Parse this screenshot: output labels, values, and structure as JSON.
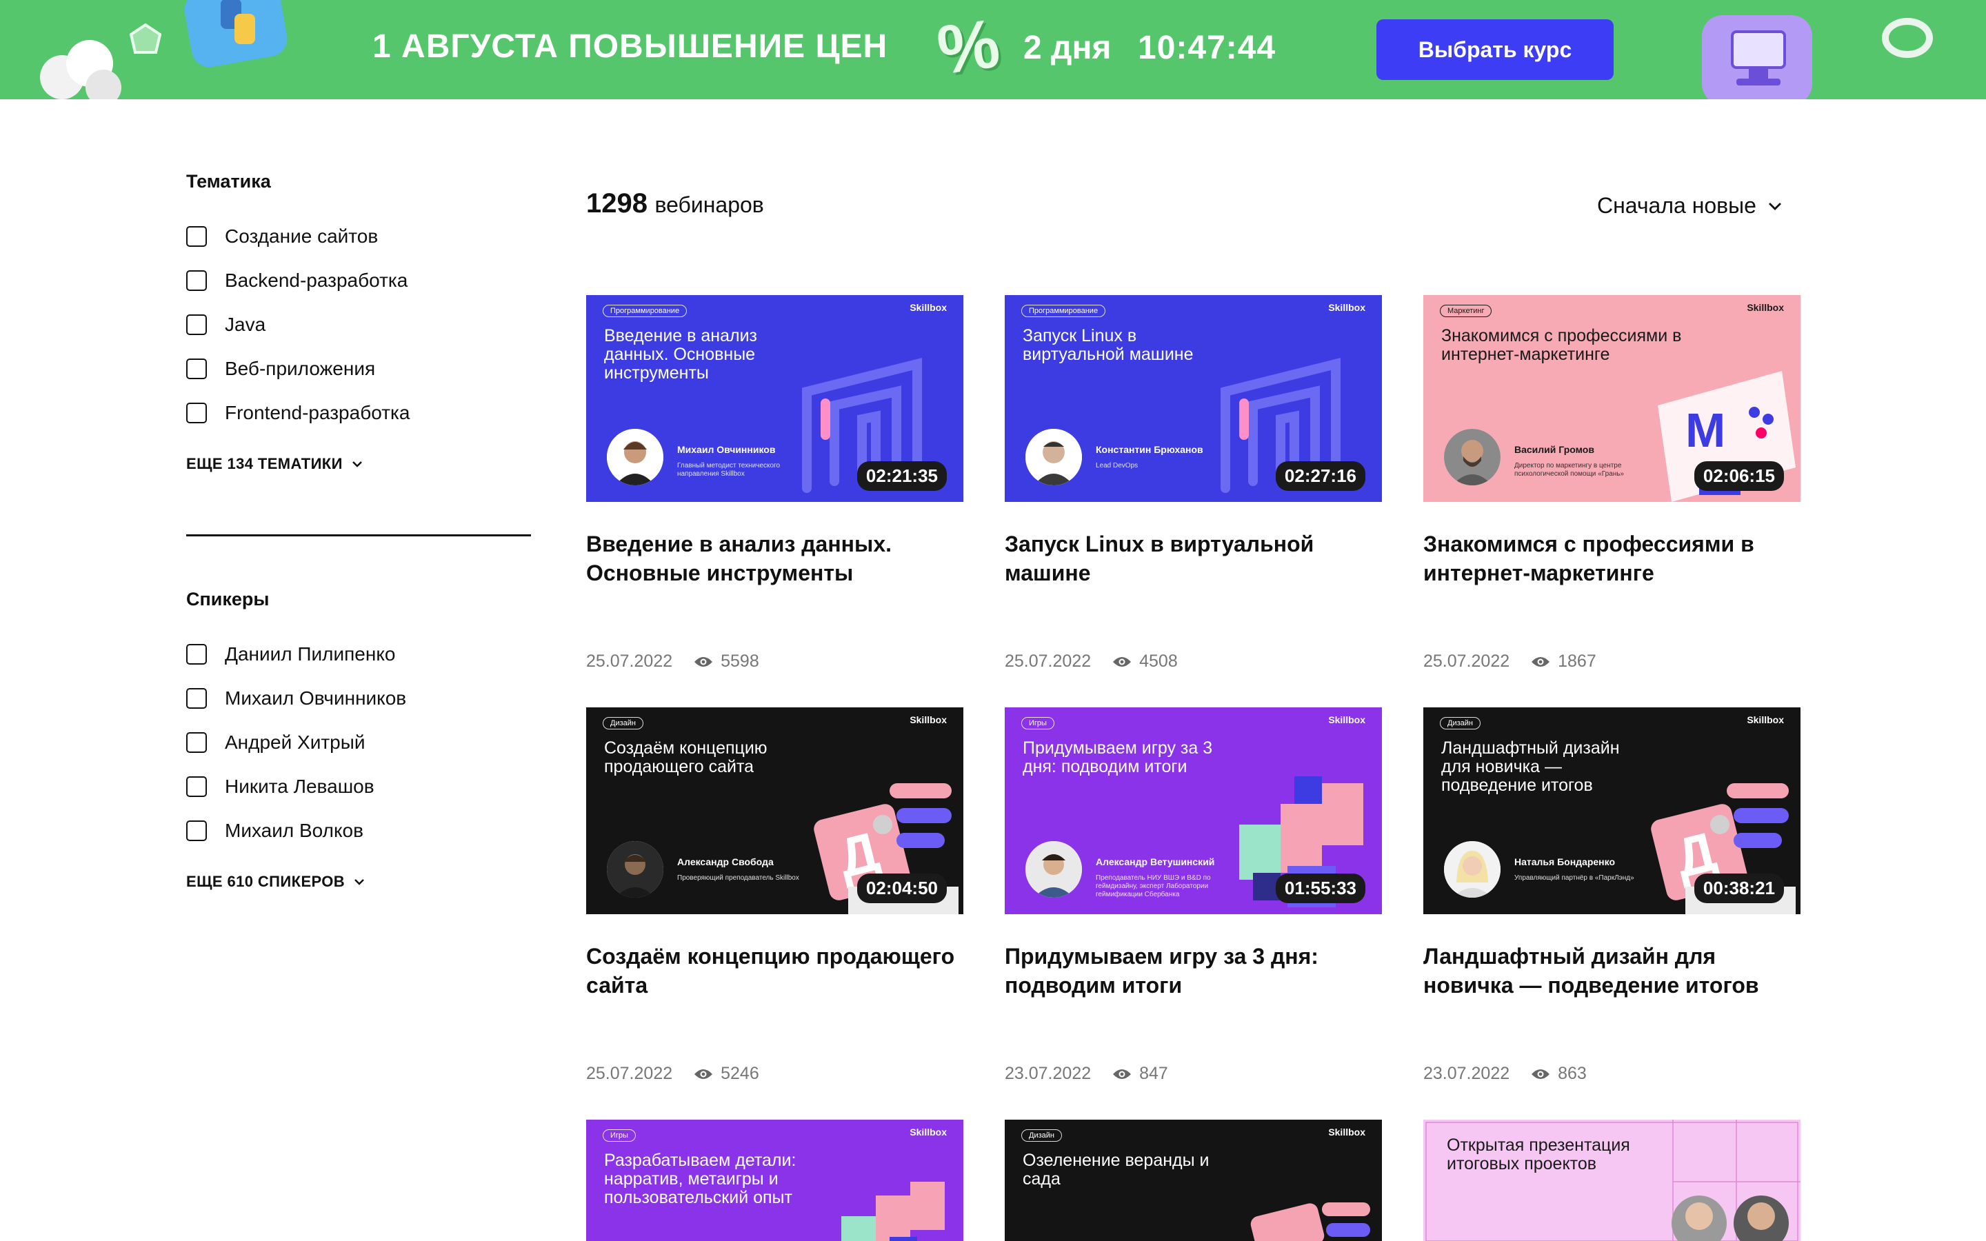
{
  "banner": {
    "title": "1 АВГУСТА ПОВЫШЕНИЕ ЦЕН",
    "percent": "%",
    "days": "2 дня",
    "timer": "10:47:44",
    "button": "Выбрать курс",
    "colors": {
      "background": "#56c66c",
      "button": "#3d3df5"
    }
  },
  "filters": {
    "topics": {
      "title": "Тематика",
      "items": [
        "Создание сайтов",
        "Backend-разработка",
        "Java",
        "Веб-приложения",
        "Frontend-разработка"
      ],
      "more": "ЕЩЕ 134 ТЕМАТИКИ"
    },
    "speakers": {
      "title": "Спикеры",
      "items": [
        "Даниил Пилипенко",
        "Михаил Овчинников",
        "Андрей Хитрый",
        "Никита Левашов",
        "Михаил Волков"
      ],
      "more": "ЕЩЕ 610 СПИКЕРОВ"
    }
  },
  "listing": {
    "count": "1298",
    "count_label": "вебинаров",
    "sort": "Сначала новые"
  },
  "cards": [
    {
      "category": "Программирование",
      "brand": "Skillbox",
      "thumb_title": "Введение в анализ данных. Основные инструменты",
      "speaker": "Михаил Овчинников",
      "speaker_role": "Главный методист технического направления Skillbox",
      "duration": "02:21:35",
      "title": "Введение в анализ данных. Основные инструменты",
      "date": "25.07.2022",
      "views": "5598"
    },
    {
      "category": "Программирование",
      "brand": "Skillbox",
      "thumb_title": "Запуск Linux в виртуальной машине",
      "speaker": "Константин Брюханов",
      "speaker_role": "Lead DevOps",
      "duration": "02:27:16",
      "title": "Запуск Linux в виртуальной машине",
      "date": "25.07.2022",
      "views": "4508"
    },
    {
      "category": "Маркетинг",
      "brand": "Skillbox",
      "thumb_title": "Знакомимся с профессиями в интернет-маркетинге",
      "speaker": "Василий Громов",
      "speaker_role": "Директор по маркетингу в центре психологической помощи «Грань»",
      "duration": "02:06:15",
      "title": "Знакомимся с профессиями в интернет-маркетинге",
      "date": "25.07.2022",
      "views": "1867"
    },
    {
      "category": "Дизайн",
      "brand": "Skillbox",
      "thumb_title": "Создаём концепцию продающего сайта",
      "speaker": "Александр Свобода",
      "speaker_role": "Проверяющий преподаватель Skillbox",
      "duration": "02:04:50",
      "title": "Создаём концепцию продающего сайта",
      "date": "25.07.2022",
      "views": "5246"
    },
    {
      "category": "Игры",
      "brand": "Skillbox",
      "thumb_title": "Придумываем игру за 3 дня: подводим итоги",
      "speaker": "Александр Ветушинский",
      "speaker_role": "Преподаватель НИУ ВШЭ и B&D по геймдизайну, эксперт Лаборатории геймификации Сбербанка",
      "duration": "01:55:33",
      "title": "Придумываем игру за 3 дня: подводим итоги",
      "date": "23.07.2022",
      "views": "847"
    },
    {
      "category": "Дизайн",
      "brand": "Skillbox",
      "thumb_title": "Ландшафтный дизайн для новичка — подведение итогов",
      "speaker": "Наталья Бондаренко",
      "speaker_role": "Управляющий партнёр в «ПаркЛэнд»",
      "duration": "00:38:21",
      "title": "Ландшафтный дизайн для новичка — подведение итогов",
      "date": "23.07.2022",
      "views": "863"
    },
    {
      "category": "Игры",
      "brand": "Skillbox",
      "thumb_title": "Разрабатываем детали: нарратив, метаигры и пользовательский опыт"
    },
    {
      "category": "Дизайн",
      "brand": "Skillbox",
      "thumb_title": "Озеленение веранды и сада"
    },
    {
      "thumb_title": "Открытая презентация итоговых проектов"
    }
  ]
}
